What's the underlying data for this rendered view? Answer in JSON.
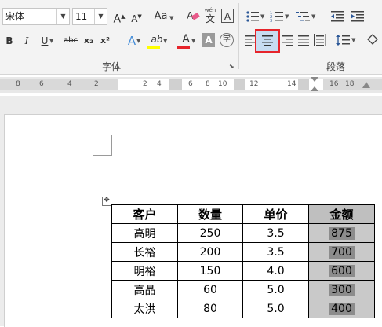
{
  "ribbon": {
    "font_name": "宋体",
    "font_size": "11",
    "grow_font": "A",
    "shrink_font": "A",
    "change_case": "Aa",
    "phonetic_top": "wén",
    "phonetic_bottom": "文",
    "char_border": "A",
    "bold": "B",
    "italic": "I",
    "underline": "U",
    "strikethrough": "abc",
    "subscript": "x₂",
    "superscript": "x²",
    "text_effects": "A",
    "highlight": "ab",
    "font_color": "A",
    "char_shading": "A",
    "enclose_char": "字",
    "font_group_label": "字体",
    "paragraph_group_label": "段落"
  },
  "ruler": {
    "numbers": [
      "8",
      "6",
      "4",
      "2",
      "2",
      "4",
      "6",
      "8",
      "10",
      "12",
      "14",
      "16",
      "18"
    ]
  },
  "table": {
    "headers": [
      "客户",
      "数量",
      "单价",
      "金额"
    ],
    "rows": [
      [
        "高明",
        "250",
        "3.5",
        "875"
      ],
      [
        "长裕",
        "200",
        "3.5",
        "700"
      ],
      [
        "明裕",
        "150",
        "4.0",
        "600"
      ],
      [
        "高晶",
        "60",
        "5.0",
        "300"
      ],
      [
        "太洪",
        "80",
        "5.0",
        "400"
      ]
    ]
  },
  "colors": {
    "selected_button_border": "#e6242b",
    "highlight_yellow": "#ffff00",
    "font_red": "#e6242b",
    "amount_column": "#c9c9c9"
  }
}
